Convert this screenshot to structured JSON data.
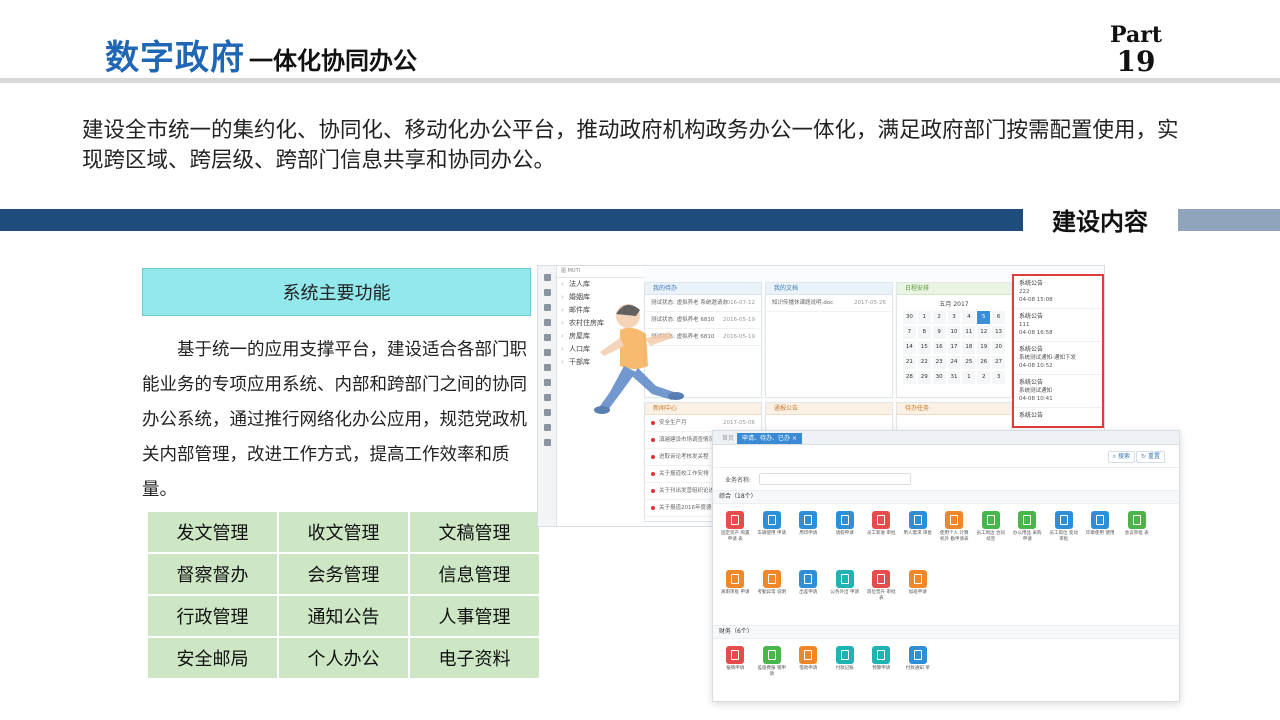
{
  "header": {
    "title_main": "数字政府",
    "title_sub": "一体化协同办公",
    "part_label": "Part",
    "part_number": "19"
  },
  "intro": "建设全市统一的集约化、协同化、移动化办公平台，推动政府机构政务办公一体化，满足政府部门按需配置使用，实现跨区域、跨层级、跨部门信息共享和协同办公。",
  "section_title": "建设内容",
  "functions": {
    "heading": "系统主要功能",
    "description": "基于统一的应用支撑平台，建设适合各部门职能业务的专项应用系统、内部和跨部门之间的协同办公系统，通过推行网络化办公应用，规范党政机关内部管理，改进工作方式，提高工作效率和质量。",
    "items": [
      "发文管理",
      "收文管理",
      "文稿管理",
      "督察督办",
      "会务管理",
      "信息管理",
      "行政管理",
      "通知公告",
      "人事管理",
      "安全邮局",
      "个人办公",
      "电子资料"
    ]
  },
  "screenshot1": {
    "tree_header": "图 MUTI",
    "tree_items": [
      "法人库",
      "婚姻库",
      "邮件库",
      "农村住房库",
      "房屋库",
      "人口库",
      "干部库"
    ],
    "panels": {
      "todo": {
        "title": "我的待办",
        "rows": [
          {
            "text": "测试状态: 虚拟养老 系统邀请办",
            "date": "2016-07-12"
          },
          {
            "text": "测试状态: 虚拟养老 6810",
            "date": "2016-05-19"
          },
          {
            "text": "测试状态: 虚拟养老 6810",
            "date": "2016-05-19"
          }
        ]
      },
      "files": {
        "title": "我的文档",
        "rows": [
          {
            "text": "知识传播休课题说明.doc",
            "date": "2017-05-26"
          }
        ]
      },
      "calendar": {
        "title": "日程安排",
        "month": "五月 2017",
        "days": [
          "30",
          "1",
          "2",
          "3",
          "4",
          "5",
          "6",
          "7",
          "8",
          "9",
          "10",
          "11",
          "12",
          "13",
          "14",
          "15",
          "16",
          "17",
          "18",
          "19",
          "20",
          "21",
          "22",
          "23",
          "24",
          "25",
          "26",
          "27",
          "28",
          "29",
          "30",
          "31",
          "1",
          "2",
          "3"
        ],
        "today": "5"
      },
      "news": {
        "title": "新闻中心",
        "rows": [
          {
            "text": "安全生产月",
            "date": "2017-05-06"
          },
          {
            "text": "滇越建设市场调查情况",
            "date": ""
          },
          {
            "text": "进取诉论考核发关程",
            "date": ""
          },
          {
            "text": "关于报道校工作安排",
            "date": ""
          },
          {
            "text": "关于刊出发营组织论述",
            "date": ""
          },
          {
            "text": "关于报道2016年度德",
            "date": ""
          }
        ]
      },
      "reports": {
        "title": "通报公告"
      },
      "tasks": {
        "title": "待办任务"
      }
    },
    "notices": [
      {
        "title": "系统公告",
        "body": "222",
        "time": "04-08 15:08"
      },
      {
        "title": "系统公告",
        "body": "111",
        "time": "04-08 16:58"
      },
      {
        "title": "系统公告",
        "body": "系统测试通知-通知下发",
        "time": "04-08 10:52"
      },
      {
        "title": "系统公告",
        "body": "系统测试通知",
        "time": "04-08 10:41"
      },
      {
        "title": "系统公告",
        "body": "",
        "time": ""
      }
    ]
  },
  "screenshot2": {
    "tabs": [
      "首页",
      "申请、待办、已办"
    ],
    "toolbar": {
      "search_btn": "搜索",
      "reset_btn": "重置"
    },
    "search_label": "业务名称:",
    "section_all": "综合（18个）",
    "apps_all": [
      {
        "label": "固定资产 购置申请 表",
        "color": "#e74c4c"
      },
      {
        "label": "车辆使用 申请",
        "color": "#2f8fd6"
      },
      {
        "label": "用印申请",
        "color": "#2f8fd6"
      },
      {
        "label": "请假申请",
        "color": "#2f8fd6"
      },
      {
        "label": "员工新进 审批",
        "color": "#e74c4c"
      },
      {
        "label": "用人需求 审批",
        "color": "#2f8fd6"
      },
      {
        "label": "使用个人 计算机外 勤申请表",
        "color": "#f0882a"
      },
      {
        "label": "员工周边 合同续签",
        "color": "#4ab54a"
      },
      {
        "label": "办公用品 采购申请",
        "color": "#4ab54a"
      },
      {
        "label": "员工岗位 变动审批",
        "color": "#2f8fd6"
      },
      {
        "label": "印章使用 使用",
        "color": "#2f8fd6"
      },
      {
        "label": "会议审批 表",
        "color": "#4ab54a"
      },
      {
        "label": "离职审批 申请",
        "color": "#f0882a"
      },
      {
        "label": "考勤异常 说明",
        "color": "#f0882a"
      },
      {
        "label": "出差申请",
        "color": "#2f8fd6"
      },
      {
        "label": "公务外出 申请",
        "color": "#1fb3b3"
      },
      {
        "label": "岗位晋升 审批表",
        "color": "#e74c4c"
      },
      {
        "label": "加班申请",
        "color": "#f0882a"
      }
    ],
    "section_finance": "财务（6个）",
    "apps_finance": [
      {
        "label": "报销申请",
        "color": "#e74c4c"
      },
      {
        "label": "差旅费报 销申请",
        "color": "#4ab54a"
      },
      {
        "label": "借款申请",
        "color": "#f0882a"
      },
      {
        "label": "付款记账",
        "color": "#1fb3b3"
      },
      {
        "label": "预算申请",
        "color": "#1fb3b3"
      },
      {
        "label": "付款通知 单",
        "color": "#2f8fd6"
      }
    ]
  }
}
